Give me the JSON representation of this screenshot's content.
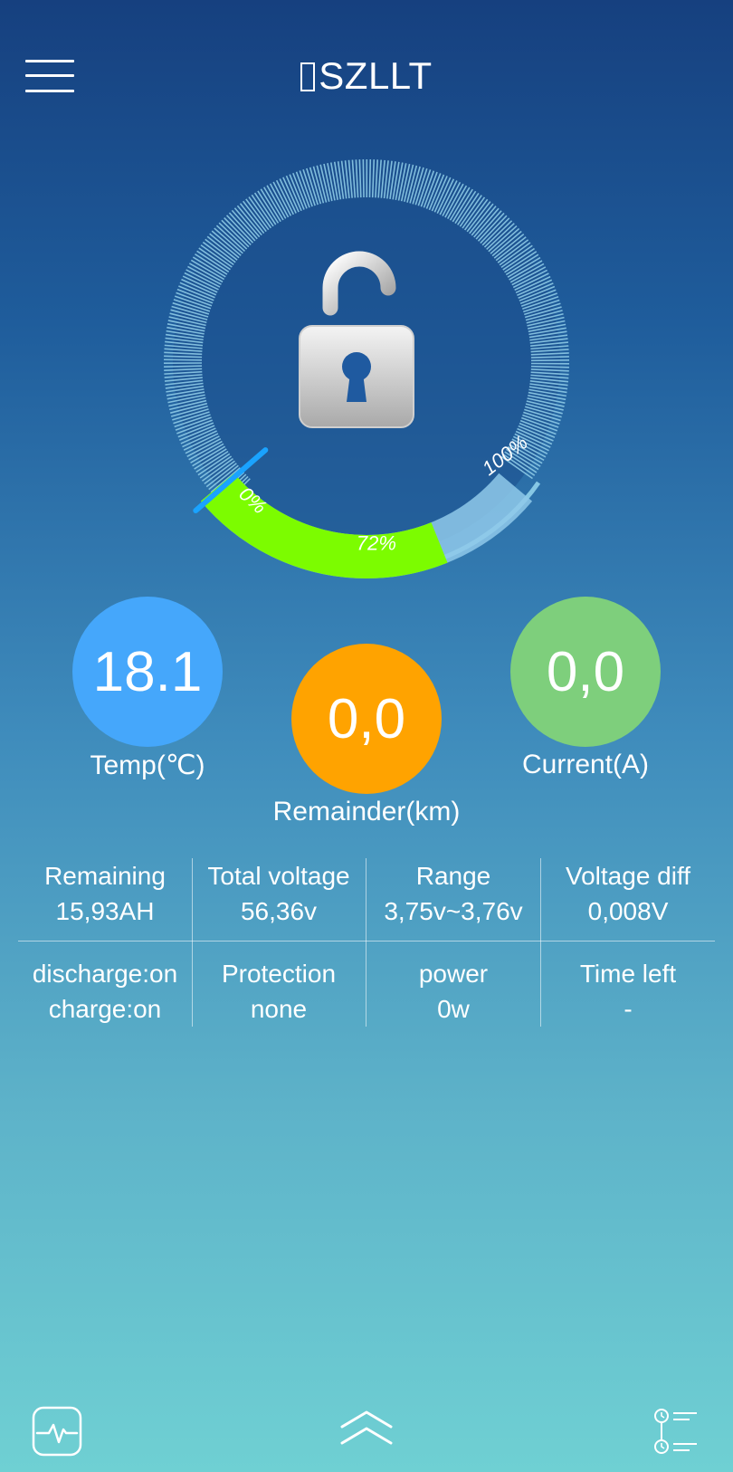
{
  "header": {
    "title": "SZLLT"
  },
  "gauge": {
    "battery_percent": 72,
    "label_min": "0%",
    "label_value": "72%",
    "label_max": "100%",
    "lock_state": "unlocked",
    "colors": {
      "track_fill": "#7cfc00",
      "track_remaining": "#8fc9ea",
      "needle": "#1aa3ff"
    }
  },
  "circles": {
    "temp": {
      "value": "18.1",
      "label": "Temp(℃)",
      "color": "#45a7fb"
    },
    "remainder": {
      "value": "0,0",
      "label": "Remainder(km)",
      "color": "#ffa300"
    },
    "current": {
      "value": "0,0",
      "label": "Current(A)",
      "color": "#7ecf7c"
    }
  },
  "stats": {
    "row1": [
      {
        "line1": "Remaining",
        "line2": "15,93AH"
      },
      {
        "line1": "Total voltage",
        "line2": "56,36v"
      },
      {
        "line1": "Range",
        "line2": "3,75v~3,76v"
      },
      {
        "line1": "Voltage diff",
        "line2": "0,008V"
      }
    ],
    "row2": [
      {
        "line1": "discharge:on",
        "line2": "charge:on"
      },
      {
        "line1": "Protection",
        "line2": "none"
      },
      {
        "line1": "power",
        "line2": "0w"
      },
      {
        "line1": "Time left",
        "line2": "-"
      }
    ]
  },
  "bottom_bar": {
    "left_icon": "pulse-icon",
    "center_icon": "double-chevron-up-icon",
    "right_icon": "history-list-icon"
  }
}
